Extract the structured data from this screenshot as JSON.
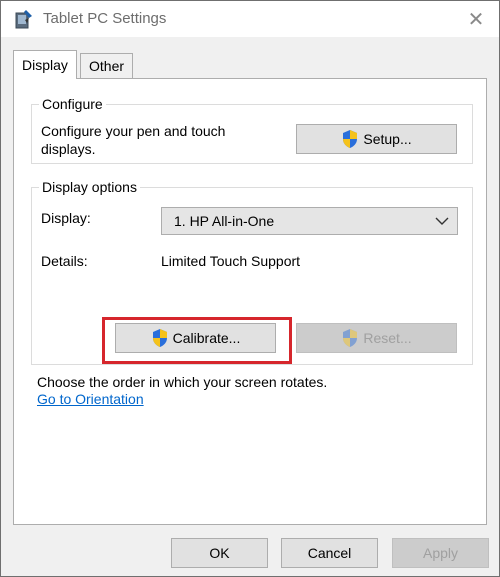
{
  "window": {
    "title": "Tablet PC Settings",
    "close_glyph": "✕"
  },
  "tabs": [
    {
      "label": "Display",
      "active": true
    },
    {
      "label": "Other",
      "active": false
    }
  ],
  "configure": {
    "legend": "Configure",
    "description": "Configure your pen and touch displays.",
    "setup_label": "Setup..."
  },
  "display_options": {
    "legend": "Display options",
    "display_label": "Display:",
    "display_value": "1. HP All-in-One",
    "details_label": "Details:",
    "details_value": "Limited Touch Support",
    "calibrate_label": "Calibrate...",
    "reset_label": "Reset..."
  },
  "orientation": {
    "text": "Choose the order in which your screen rotates.",
    "link": "Go to Orientation"
  },
  "footer": {
    "ok_label": "OK",
    "cancel_label": "Cancel",
    "apply_label": "Apply"
  },
  "colors": {
    "highlight": "#d6262c",
    "link": "#0066cc",
    "shield_blue": "#2a6fdb",
    "shield_yellow": "#f5c21b"
  }
}
